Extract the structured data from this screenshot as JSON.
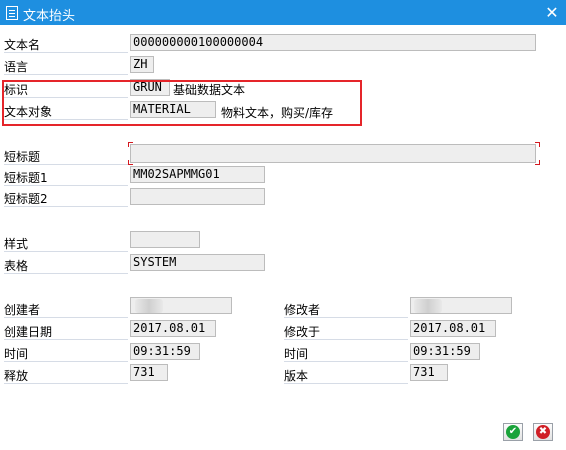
{
  "window": {
    "title": "文本抬头",
    "close_glyph": "✕"
  },
  "header_fields": {
    "text_name_label": "文本名",
    "text_name_value": "000000000100000004",
    "language_label": "语言",
    "language_value": "ZH",
    "id_label": "标识",
    "id_value": "GRUN",
    "id_desc": "基础数据文本",
    "object_label": "文本对象",
    "object_value": "MATERIAL",
    "object_desc": "物料文本，购买/库存"
  },
  "titles": {
    "short_title_label": "短标题",
    "short_title_value": "",
    "short_title1_label": "短标题1",
    "short_title1_value": "MM02SAPMMG01",
    "short_title2_label": "短标题2",
    "short_title2_value": ""
  },
  "format": {
    "style_label": "样式",
    "style_value": "",
    "form_label": "表格",
    "form_value": "SYSTEM"
  },
  "admin": {
    "created_by_label": "创建者",
    "created_by_value": "",
    "created_date_label": "创建日期",
    "created_date_value": "2017.08.01",
    "created_time_label": "时间",
    "created_time_value": "09:31:59",
    "release_label": "释放",
    "release_value": "731",
    "changed_by_label": "修改者",
    "changed_by_value": "",
    "changed_on_label": "修改于",
    "changed_on_value": "2017.08.01",
    "changed_time_label": "时间",
    "changed_time_value": "09:31:59",
    "version_label": "版本",
    "version_value": "731"
  },
  "footer": {
    "ok_glyph": "✔",
    "cancel_glyph": "✖"
  },
  "colors": {
    "titlebar": "#1e8fe0",
    "highlight_border": "#e5252a",
    "ok_green": "#1aa33a",
    "cancel_red": "#d01f26"
  }
}
